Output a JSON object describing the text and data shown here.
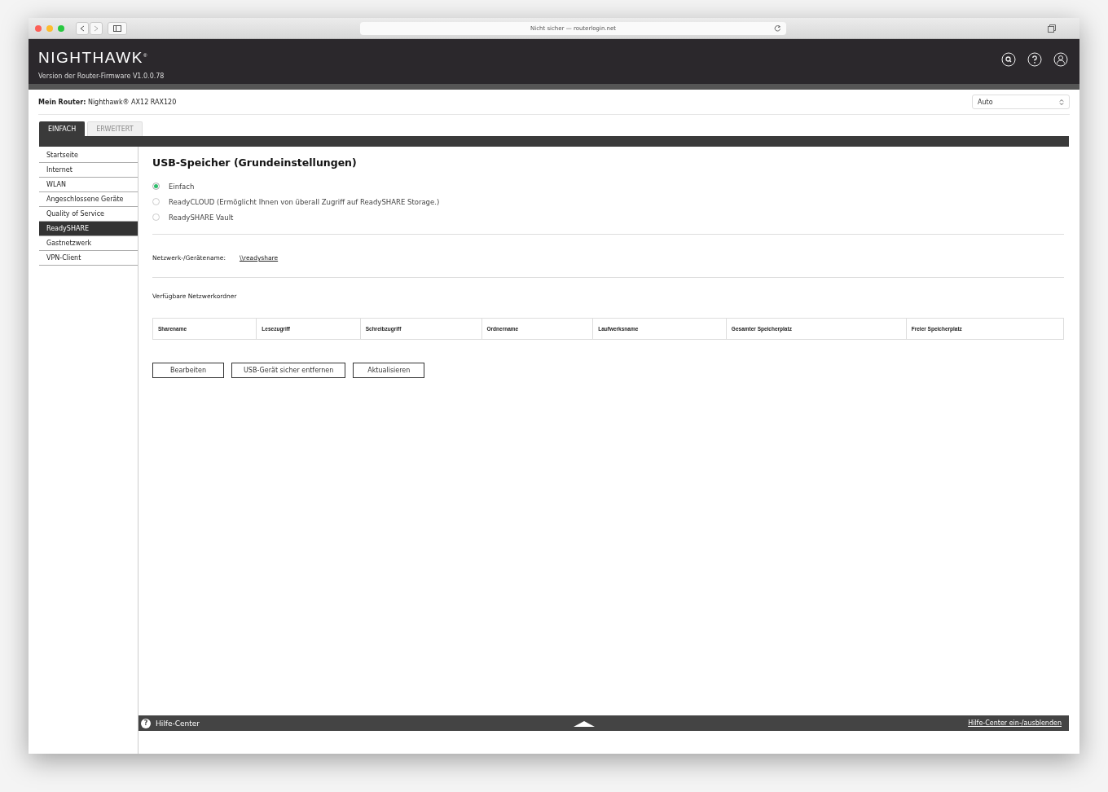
{
  "browser": {
    "address": "Nicht sicher — routerlogin.net"
  },
  "header": {
    "logo": "NIGHTHAWK$^{®}$",
    "firmware": "Version der Router-Firmware V1.0.0.78"
  },
  "router": {
    "text": "**Mein Router:** Nighthawk® AX12 RAX120",
    "language": "Auto"
  },
  "tabs": [
    {
      "label": "EINFACH",
      "selected": true
    },
    {
      "label": "ERWEITERT",
      "selected": false
    }
  ],
  "sidebar": {
    "items": [
      {
        "label": "Startseite",
        "selected": false
      },
      {
        "label": "Internet",
        "selected": false
      },
      {
        "label": "WLAN",
        "selected": false
      },
      {
        "label": "Angeschlossene Geräte",
        "selected": false
      },
      {
        "label": "Quality of Service",
        "selected": false
      },
      {
        "label": "ReadySHARE",
        "selected": true
      },
      {
        "label": "Gastnetzwerk",
        "selected": false
      },
      {
        "label": "VPN-Client",
        "selected": false
      }
    ]
  },
  "page": {
    "title": "USB-Speicher (Grundeinstellungen)",
    "options": [
      {
        "label": "Einfach",
        "selected": true
      },
      {
        "label": "ReadyCLOUD (Ermöglicht Ihnen von überall Zugriff auf ReadySHARE Storage.)",
        "selected": false
      },
      {
        "label": "ReadySHARE Vault",
        "selected": false
      }
    ],
    "network_name": {
      "label": "Netzwerk-/Gerätename:",
      "value": "\\\\readyshare"
    },
    "folders_title": "Verfügbare Netzwerkordner",
    "table": {
      "columns": [
        "Sharename",
        "Lesezugriff",
        "Schreibzugriff",
        "Ordnername",
        "Laufwerksname",
        "Gesamter Speicherplatz",
        "Freier Speicherplatz"
      ]
    },
    "buttons": [
      "Bearbeiten",
      "USB-Gerät sicher entfernen",
      "Aktualisieren"
    ]
  },
  "help_bar": {
    "label": "Hilfe-Center",
    "icon": "?",
    "toggle": "Hilfe-Center ein-/ausblenden"
  }
}
